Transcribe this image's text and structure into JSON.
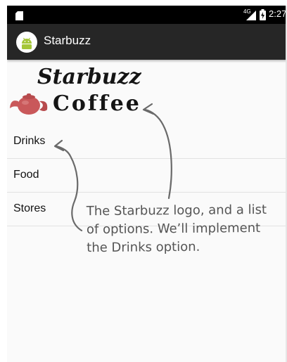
{
  "status_bar": {
    "network": "4G",
    "time": "2:27"
  },
  "action_bar": {
    "title": "Starbuzz",
    "icon": "android-icon"
  },
  "logo": {
    "line1": "Starbuzz",
    "line2": "Coffee",
    "icon": "teapot-icon"
  },
  "options": [
    {
      "label": "Drinks"
    },
    {
      "label": "Food"
    },
    {
      "label": "Stores"
    }
  ],
  "annotation": {
    "text": "The Starbuzz logo, and a list of options. We’ll implement the Drinks option."
  },
  "colors": {
    "status_bar": "#000000",
    "action_bar": "#262626",
    "background": "#fafafa",
    "annotation": "#555555",
    "android_green": "#a4c639"
  }
}
